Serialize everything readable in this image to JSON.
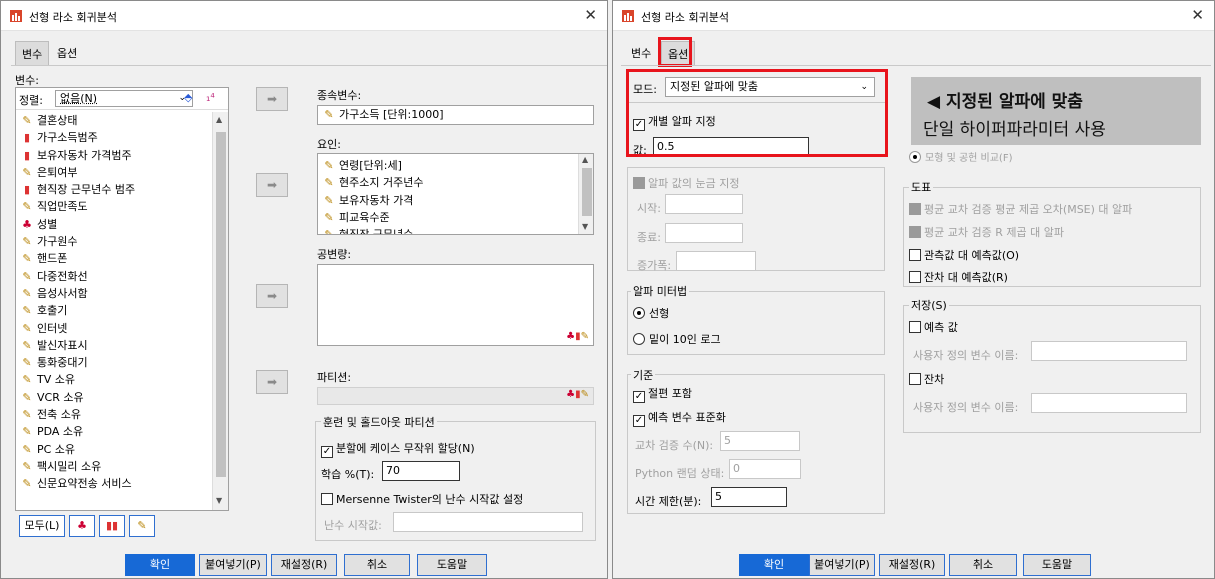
{
  "window1": {
    "title": "선형 라소 회귀분석",
    "close": "✕",
    "tabs": [
      "변수",
      "옵션"
    ],
    "variables_label": "변수:",
    "sort_label": "정렬:",
    "sort_value": "없음(N)",
    "variables": [
      {
        "icon": "pencil",
        "label": "결혼상태"
      },
      {
        "icon": "bars",
        "label": "가구소득범주"
      },
      {
        "icon": "bars",
        "label": "보유자동차 가격범주"
      },
      {
        "icon": "pencil",
        "label": "은퇴여부"
      },
      {
        "icon": "bars",
        "label": "현직장 근무년수 범주"
      },
      {
        "icon": "pencil",
        "label": "직업만족도"
      },
      {
        "icon": "nominal",
        "label": "성별"
      },
      {
        "icon": "pencil",
        "label": "가구원수"
      },
      {
        "icon": "pencil",
        "label": "핸드폰"
      },
      {
        "icon": "pencil",
        "label": "다중전화선"
      },
      {
        "icon": "pencil",
        "label": "음성사서함"
      },
      {
        "icon": "pencil",
        "label": "호출기"
      },
      {
        "icon": "pencil",
        "label": "인터넷"
      },
      {
        "icon": "pencil",
        "label": "발신자표시"
      },
      {
        "icon": "pencil",
        "label": "통화중대기"
      },
      {
        "icon": "pencil",
        "label": "TV 소유"
      },
      {
        "icon": "pencil",
        "label": "VCR 소유"
      },
      {
        "icon": "pencil",
        "label": "전축 소유"
      },
      {
        "icon": "pencil",
        "label": "PDA 소유"
      },
      {
        "icon": "pencil",
        "label": "PC 소유"
      },
      {
        "icon": "pencil",
        "label": "팩시밀리 소유"
      },
      {
        "icon": "pencil",
        "label": "신문요약전송 서비스"
      }
    ],
    "filter_all": "모두(L)",
    "dependent_label": "종속변수:",
    "dependent_value": "가구소득 [단위:1000]",
    "factors_label": "요인:",
    "factors": [
      "연령[단위:세]",
      "현주소지 거주년수",
      "보유자동차 가격",
      "피교육수준",
      "현직장 근무년수"
    ],
    "covariates_label": "공변량:",
    "partition_label": "파티션:",
    "holdout_title": "훈련 및 홀드아웃 파티션",
    "random_assign": "분할에 케이스 무작위 할당(N)",
    "train_label": "학습 %(T):",
    "train_value": "70",
    "mersenne": "Mersenne Twister의 난수 시작값 설정",
    "seed_label": "난수 시작값:",
    "buttons": [
      "확인",
      "붙여넣기(P)",
      "재설정(R)",
      "취소",
      "도움말"
    ]
  },
  "window2": {
    "title": "선형 라소 회귀분석",
    "close": "✕",
    "tabs": [
      "변수",
      "옵션"
    ],
    "mode_label": "모드:",
    "mode_value": "지정된 알파에 맞춤",
    "alpha_check": "개별 알파 지정",
    "value_label": "값:",
    "value": "0.5",
    "grid_check": "알파 값의 눈금 지정",
    "start_label": "시작:",
    "end_label": "종료:",
    "step_label": "증가폭:",
    "metric_title": "알파 미터법",
    "metric_linear": "선형",
    "metric_log": "밑이 10인 로그",
    "criteria_title": "기준",
    "include_intercept": "절편 포함",
    "standardize": "예측 변수 표준화",
    "cv_label": "교차 검증 수(N):",
    "cv_value": "5",
    "python_label": "Python 랜덤 상태:",
    "python_value": "0",
    "time_label": "시간 제한(분):",
    "time_value": "5",
    "plots_title": "도표",
    "plot_mse": "평균 교차 검증 평균 제곱 오차(MSE) 대 알파",
    "plot_r2": "평균 교차 검증 R 제곱 대 알파",
    "plot_obs": "관측값 대 예측값(O)",
    "plot_resid": "잔차 대 예측값(R)",
    "save_title": "저장(S)",
    "save_pred": "예측 값",
    "save_pred_name": "사용자 정의 변수 이름:",
    "save_resid": "잔차",
    "save_resid_name": "사용자 정의 변수 이름:",
    "hidden_text": "모형 및 공헌 비교(F)",
    "buttons": [
      "확인",
      "붙여넣기(P)",
      "재설정(R)",
      "취소",
      "도움말"
    ]
  },
  "callout": {
    "line1": "◀ 지정된 알파에 맞춤",
    "line2": "단일 하이퍼파라미터 사용"
  },
  "colors": {
    "accent": "#1769d6",
    "highlight": "#e8141c",
    "callout_bg": "#bfbfbf"
  }
}
